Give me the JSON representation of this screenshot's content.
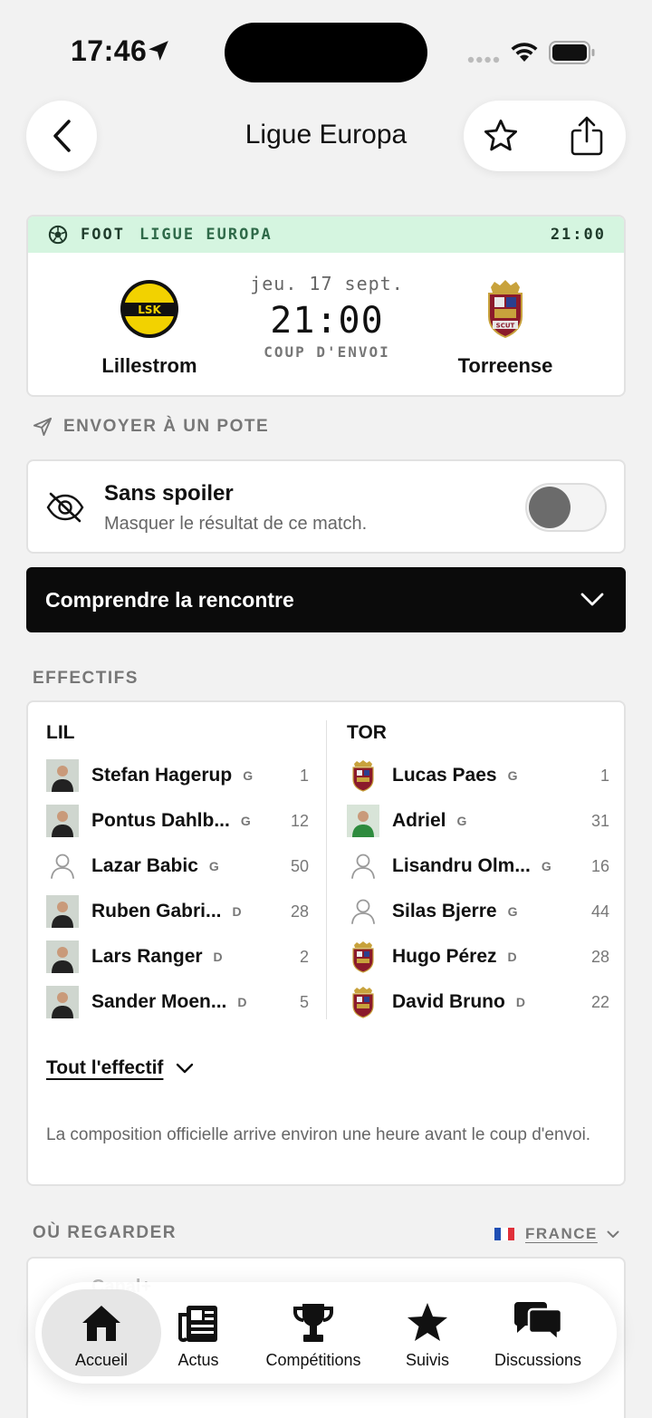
{
  "status_bar": {
    "time": "17:46"
  },
  "header": {
    "title": "Ligue Europa"
  },
  "match": {
    "sport": "FOOT",
    "competition": "LIGUE EUROPA",
    "header_time": "21:00",
    "date": "jeu. 17 sept.",
    "kickoff_time": "21:00",
    "kickoff_label": "COUP D'ENVOI",
    "home": {
      "name": "Lillestrom",
      "logo_text": "LSK",
      "color": "#f2d200"
    },
    "away": {
      "name": "Torreense",
      "logo_text": "SCUT",
      "color": "#8b1a2b"
    }
  },
  "send": {
    "label": "ENVOYER À UN POTE"
  },
  "spoiler": {
    "title": "Sans spoiler",
    "subtitle": "Masquer le résultat de ce match.",
    "enabled": false
  },
  "understand": {
    "label": "Comprendre la rencontre"
  },
  "roster": {
    "section_label": "EFFECTIFS",
    "home": {
      "abbr": "LIL",
      "players": [
        {
          "name": "Stefan Hagerup",
          "pos": "G",
          "number": "1",
          "avatar": "photo"
        },
        {
          "name": "Pontus Dahlb...",
          "pos": "G",
          "number": "12",
          "avatar": "photo"
        },
        {
          "name": "Lazar Babic",
          "pos": "G",
          "number": "50",
          "avatar": "placeholder"
        },
        {
          "name": "Ruben Gabri...",
          "pos": "D",
          "number": "28",
          "avatar": "photo"
        },
        {
          "name": "Lars Ranger",
          "pos": "D",
          "number": "2",
          "avatar": "photo"
        },
        {
          "name": "Sander Moen...",
          "pos": "D",
          "number": "5",
          "avatar": "photo"
        }
      ]
    },
    "away": {
      "abbr": "TOR",
      "players": [
        {
          "name": "Lucas Paes",
          "pos": "G",
          "number": "1",
          "avatar": "crest"
        },
        {
          "name": "Adriel",
          "pos": "G",
          "number": "31",
          "avatar": "photo"
        },
        {
          "name": "Lisandru Olm...",
          "pos": "G",
          "number": "16",
          "avatar": "placeholder"
        },
        {
          "name": "Silas Bjerre",
          "pos": "G",
          "number": "44",
          "avatar": "placeholder"
        },
        {
          "name": "Hugo Pérez",
          "pos": "D",
          "number": "28",
          "avatar": "crest"
        },
        {
          "name": "David Bruno",
          "pos": "D",
          "number": "22",
          "avatar": "crest"
        }
      ]
    },
    "full_roster_label": "Tout l'effectif",
    "note": "La composition officielle arrive environ une heure avant le coup d'envoi."
  },
  "watch": {
    "section_label": "OÙ REGARDER",
    "country": "FRANCE",
    "faded_text": "Canal+"
  },
  "tab_bar": {
    "tabs": [
      {
        "label": "Accueil",
        "icon": "home-icon",
        "active": true
      },
      {
        "label": "Actus",
        "icon": "newspaper-icon",
        "active": false
      },
      {
        "label": "Compétitions",
        "icon": "trophy-icon",
        "active": false
      },
      {
        "label": "Suivis",
        "icon": "star-icon",
        "active": false
      },
      {
        "label": "Discussions",
        "icon": "chat-bubbles-icon",
        "active": false
      }
    ]
  }
}
